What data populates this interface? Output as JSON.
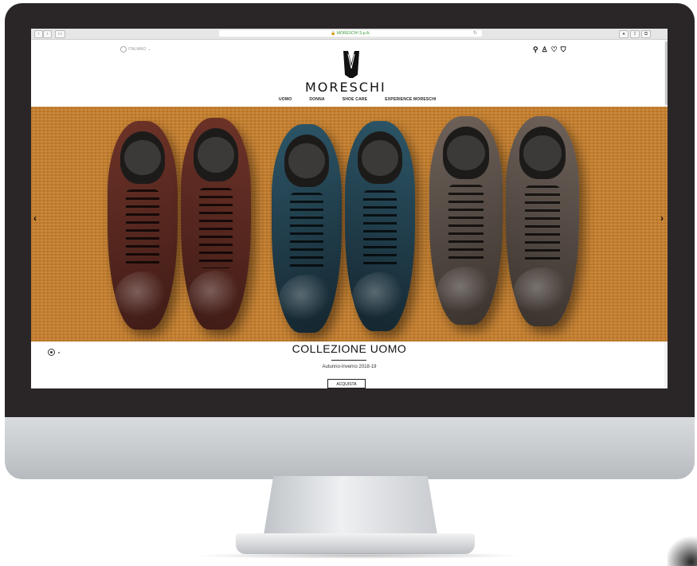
{
  "browser": {
    "url_text": "MORESCHI S.p.A.",
    "back_icon": "chevron-left-icon",
    "forward_icon": "chevron-right-icon",
    "sidebar_icon": "sidebar-icon",
    "reload_icon": "reload-icon",
    "right_icons": [
      "info-icon",
      "share-icon",
      "tabs-icon"
    ]
  },
  "header": {
    "language": "ITALIANO",
    "brand": "MORESCHI",
    "icons": [
      "search-icon",
      "account-icon",
      "wishlist-icon",
      "cart-icon"
    ]
  },
  "nav": {
    "items": [
      "UOMO",
      "DONNA",
      "SHOE CARE",
      "EXPERIENCE MORESCHI"
    ]
  },
  "hero": {
    "background_color": "#c8802d",
    "shoe_colors": [
      "#5a2a22",
      "#5a2a22",
      "#1f3e4c",
      "#1f3e4c",
      "#5c5048",
      "#5c5048"
    ]
  },
  "collection": {
    "title": "COLLEZIONE UOMO",
    "subtitle": "Autunno-Inverno 2018-19",
    "cta": "ACQUISTA"
  }
}
